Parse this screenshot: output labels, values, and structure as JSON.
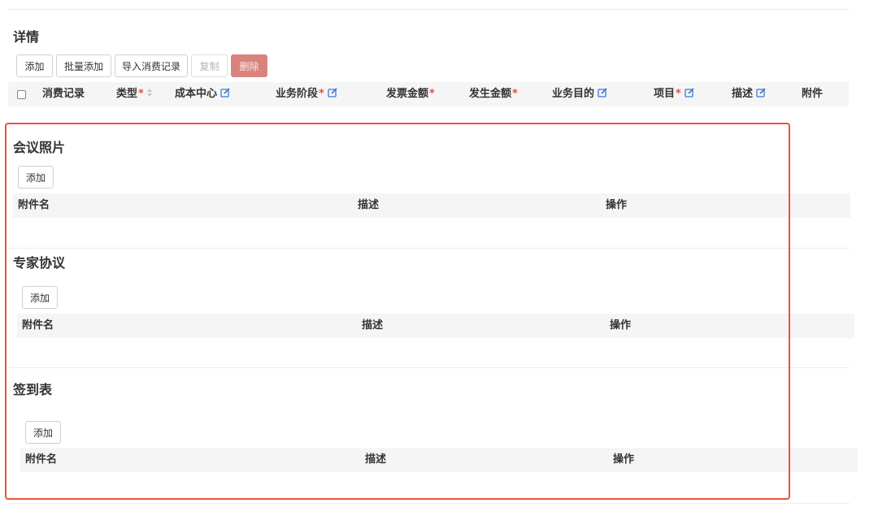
{
  "detail": {
    "title": "详情",
    "toolbar": {
      "add": "添加",
      "batch_add": "批量添加",
      "import": "导入消费记录",
      "copy": "复制",
      "delete": "删除"
    },
    "columns": [
      {
        "label": "消费记录",
        "required": false,
        "editable": false,
        "sortable": false
      },
      {
        "label": "类型",
        "required": true,
        "editable": false,
        "sortable": true
      },
      {
        "label": "成本中心",
        "required": false,
        "editable": true,
        "sortable": false
      },
      {
        "label": "业务阶段",
        "required": true,
        "editable": true,
        "sortable": false
      },
      {
        "label": "发票金额",
        "required": true,
        "editable": false,
        "sortable": false
      },
      {
        "label": "发生金额",
        "required": true,
        "editable": false,
        "sortable": false
      },
      {
        "label": "业务目的",
        "required": false,
        "editable": true,
        "sortable": false
      },
      {
        "label": "项目",
        "required": true,
        "editable": true,
        "sortable": false
      },
      {
        "label": "描述",
        "required": false,
        "editable": true,
        "sortable": false
      },
      {
        "label": "附件",
        "required": false,
        "editable": false,
        "sortable": false
      }
    ],
    "required_mark": "*"
  },
  "sections": [
    {
      "title": "会议照片",
      "add_label": "添加",
      "columns": [
        "附件名",
        "描述",
        "操作"
      ]
    },
    {
      "title": "专家协议",
      "add_label": "添加",
      "columns": [
        "附件名",
        "描述",
        "操作"
      ]
    },
    {
      "title": "签到表",
      "add_label": "添加",
      "columns": [
        "附件名",
        "描述",
        "操作"
      ]
    }
  ],
  "colors": {
    "highlight_border": "#e8533b",
    "required": "#d9534f",
    "edit_icon": "#3a7bd5",
    "delete_button": "#d9837e"
  }
}
